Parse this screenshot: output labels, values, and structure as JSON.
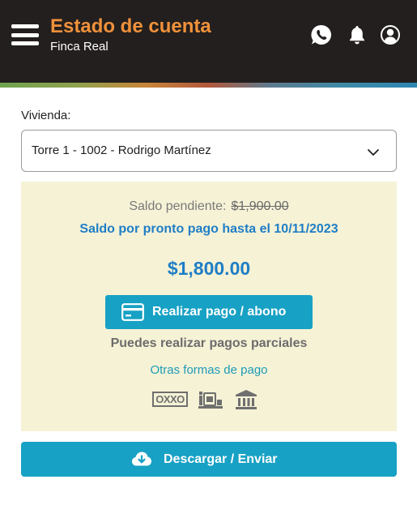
{
  "header": {
    "title": "Estado de cuenta",
    "subtitle": "Finca Real",
    "icons": [
      "menu-icon",
      "whatsapp-icon",
      "bell-icon",
      "user-icon"
    ],
    "colors": {
      "background": "#231f1e",
      "title": "#f0913a"
    }
  },
  "vivienda": {
    "label": "Vivienda:",
    "selected": "Torre 1 - 1002 - Rodrigo Martínez"
  },
  "balance": {
    "pending_label": "Saldo pendiente:",
    "pending_amount": "$1,900.00",
    "pronto_pago": "Saldo por pronto pago hasta el 10/11/2023",
    "amount": "$1,800.00",
    "pay_button": "Realizar pago / abono",
    "partial_note": "Puedes realizar pagos parciales",
    "other_methods": "Otras formas de pago",
    "payment_icons": [
      "oxxo-icon",
      "store-deposit-icon",
      "bank-icon"
    ],
    "oxxo_text": "OXXO",
    "colors": {
      "panel": "#f6f2d6",
      "accent": "#1f7ec6",
      "button": "#17a1c4"
    }
  },
  "actions": {
    "download_button": "Descargar / Enviar"
  }
}
